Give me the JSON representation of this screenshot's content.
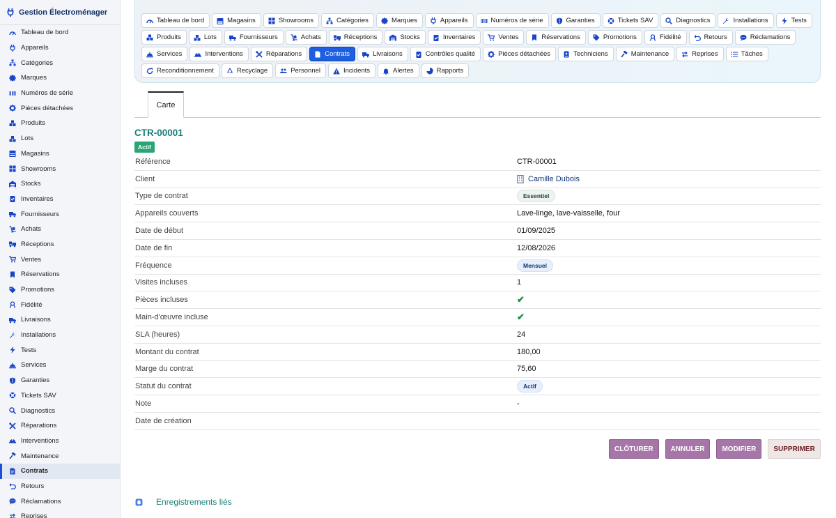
{
  "app": {
    "title": "Gestion Électroménager"
  },
  "sidebar": {
    "items": [
      {
        "label": "Tableau de bord",
        "icon": "gauge-icon"
      },
      {
        "label": "Appareils",
        "icon": "plug-icon"
      },
      {
        "label": "Catégories",
        "icon": "sitemap-icon"
      },
      {
        "label": "Marques",
        "icon": "badge-icon"
      },
      {
        "label": "Numéros de série",
        "icon": "barcode-icon"
      },
      {
        "label": "Pièces détachées",
        "icon": "gear-icon"
      },
      {
        "label": "Produits",
        "icon": "boxes-icon"
      },
      {
        "label": "Lots",
        "icon": "cubes-icon"
      },
      {
        "label": "Magasins",
        "icon": "store-icon"
      },
      {
        "label": "Showrooms",
        "icon": "grid-icon"
      },
      {
        "label": "Stocks",
        "icon": "warehouse-icon"
      },
      {
        "label": "Inventaires",
        "icon": "clipboard-check-icon"
      },
      {
        "label": "Fournisseurs",
        "icon": "truck-icon"
      },
      {
        "label": "Achats",
        "icon": "dolly-icon"
      },
      {
        "label": "Réceptions",
        "icon": "truck-loading-icon"
      },
      {
        "label": "Ventes",
        "icon": "cart-icon"
      },
      {
        "label": "Réservations",
        "icon": "bookmark-icon"
      },
      {
        "label": "Promotions",
        "icon": "tags-icon"
      },
      {
        "label": "Fidélité",
        "icon": "ribbon-icon"
      },
      {
        "label": "Livraisons",
        "icon": "shipping-icon"
      },
      {
        "label": "Installations",
        "icon": "wrench-icon"
      },
      {
        "label": "Tests",
        "icon": "bolt-icon"
      },
      {
        "label": "Services",
        "icon": "service-bell-icon"
      },
      {
        "label": "Garanties",
        "icon": "shield-icon"
      },
      {
        "label": "Tickets SAV",
        "icon": "lifebuoy-icon"
      },
      {
        "label": "Diagnostics",
        "icon": "search-icon"
      },
      {
        "label": "Réparations",
        "icon": "tools-icon"
      },
      {
        "label": "Interventions",
        "icon": "hard-hat-icon"
      },
      {
        "label": "Maintenance",
        "icon": "hammer-icon"
      },
      {
        "label": "Contrats",
        "icon": "contract-icon"
      },
      {
        "label": "Retours",
        "icon": "undo-icon"
      },
      {
        "label": "Réclamations",
        "icon": "comment-icon"
      },
      {
        "label": "Reprises",
        "icon": "exchange-icon"
      }
    ],
    "active_index": 29
  },
  "tabs": {
    "items": [
      {
        "label": "Tableau de bord",
        "icon": "gauge-icon"
      },
      {
        "label": "Magasins",
        "icon": "store-icon"
      },
      {
        "label": "Showrooms",
        "icon": "grid-icon"
      },
      {
        "label": "Catégories",
        "icon": "sitemap-icon"
      },
      {
        "label": "Marques",
        "icon": "badge-icon"
      },
      {
        "label": "Appareils",
        "icon": "plug-icon"
      },
      {
        "label": "Numéros de série",
        "icon": "barcode-icon"
      },
      {
        "label": "Garanties",
        "icon": "shield-icon"
      },
      {
        "label": "Tickets SAV",
        "icon": "lifebuoy-icon"
      },
      {
        "label": "Diagnostics",
        "icon": "search-icon"
      },
      {
        "label": "Installations",
        "icon": "wrench-icon"
      },
      {
        "label": "Tests",
        "icon": "bolt-icon"
      },
      {
        "label": "Produits",
        "icon": "boxes-icon"
      },
      {
        "label": "Lots",
        "icon": "cubes-icon"
      },
      {
        "label": "Fournisseurs",
        "icon": "truck-icon"
      },
      {
        "label": "Achats",
        "icon": "dolly-icon"
      },
      {
        "label": "Réceptions",
        "icon": "truck-loading-icon"
      },
      {
        "label": "Stocks",
        "icon": "warehouse-icon"
      },
      {
        "label": "Inventaires",
        "icon": "clipboard-check-icon"
      },
      {
        "label": "Ventes",
        "icon": "cart-icon"
      },
      {
        "label": "Réservations",
        "icon": "bookmark-icon"
      },
      {
        "label": "Promotions",
        "icon": "tags-icon"
      },
      {
        "label": "Fidélité",
        "icon": "ribbon-icon"
      },
      {
        "label": "Retours",
        "icon": "undo-icon"
      },
      {
        "label": "Réclamations",
        "icon": "comment-icon"
      },
      {
        "label": "Services",
        "icon": "service-bell-icon"
      },
      {
        "label": "Interventions",
        "icon": "hard-hat-icon"
      },
      {
        "label": "Réparations",
        "icon": "tools-icon"
      },
      {
        "label": "Contrats",
        "icon": "contract-icon"
      },
      {
        "label": "Livraisons",
        "icon": "shipping-icon"
      },
      {
        "label": "Contrôles qualité",
        "icon": "clipboard-check-icon"
      },
      {
        "label": "Pièces détachées",
        "icon": "gear-icon"
      },
      {
        "label": "Techniciens",
        "icon": "id-badge-icon"
      },
      {
        "label": "Maintenance",
        "icon": "hammer-icon"
      },
      {
        "label": "Reprises",
        "icon": "exchange-icon"
      },
      {
        "label": "Tâches",
        "icon": "list-icon"
      },
      {
        "label": "Reconditionnement",
        "icon": "refresh-icon"
      },
      {
        "label": "Recyclage",
        "icon": "recycle-icon"
      },
      {
        "label": "Personnel",
        "icon": "users-icon"
      },
      {
        "label": "Incidents",
        "icon": "warning-icon"
      },
      {
        "label": "Alertes",
        "icon": "bell-icon"
      },
      {
        "label": "Rapports",
        "icon": "pie-chart-icon"
      }
    ],
    "active_index": 28
  },
  "subtab": {
    "label": "Carte"
  },
  "record": {
    "id": "CTR-00001",
    "status_badge": "Actif",
    "fields": {
      "reference": {
        "label": "Référence",
        "value": "CTR-00001"
      },
      "client": {
        "label": "Client",
        "value": "Camille Dubois"
      },
      "type": {
        "label": "Type de contrat",
        "value": "Essentiel"
      },
      "appareils": {
        "label": "Appareils couverts",
        "value": "Lave-linge, lave-vaisselle, four"
      },
      "debut": {
        "label": "Date de début",
        "value": "01/09/2025"
      },
      "fin": {
        "label": "Date de fin",
        "value": "12/08/2026"
      },
      "frequence": {
        "label": "Fréquence",
        "value": "Mensuel"
      },
      "visites": {
        "label": "Visites incluses",
        "value": "1"
      },
      "pieces": {
        "label": "Pièces incluses",
        "value": "✔"
      },
      "main_oeuvre": {
        "label": "Main-d'œuvre incluse",
        "value": "✔"
      },
      "sla": {
        "label": "SLA (heures)",
        "value": "24"
      },
      "montant": {
        "label": "Montant du contrat",
        "value": "180,00"
      },
      "marge": {
        "label": "Marge du contrat",
        "value": "75,60"
      },
      "statut": {
        "label": "Statut du contrat",
        "value": "Actif"
      },
      "note": {
        "label": "Note",
        "value": "-"
      },
      "creation": {
        "label": "Date de création",
        "value": ""
      }
    }
  },
  "actions": {
    "cloturer": "CLÔTURER",
    "annuler": "ANNULER",
    "modifier": "MODIFIER",
    "supprimer": "SUPPRIMER"
  },
  "related": {
    "title": "Enregistrements liés"
  },
  "colors": {
    "accent": "#1d5fe0",
    "teal": "#1a7f7a",
    "action": "#a776a8",
    "badge_green": "#2aa573"
  }
}
